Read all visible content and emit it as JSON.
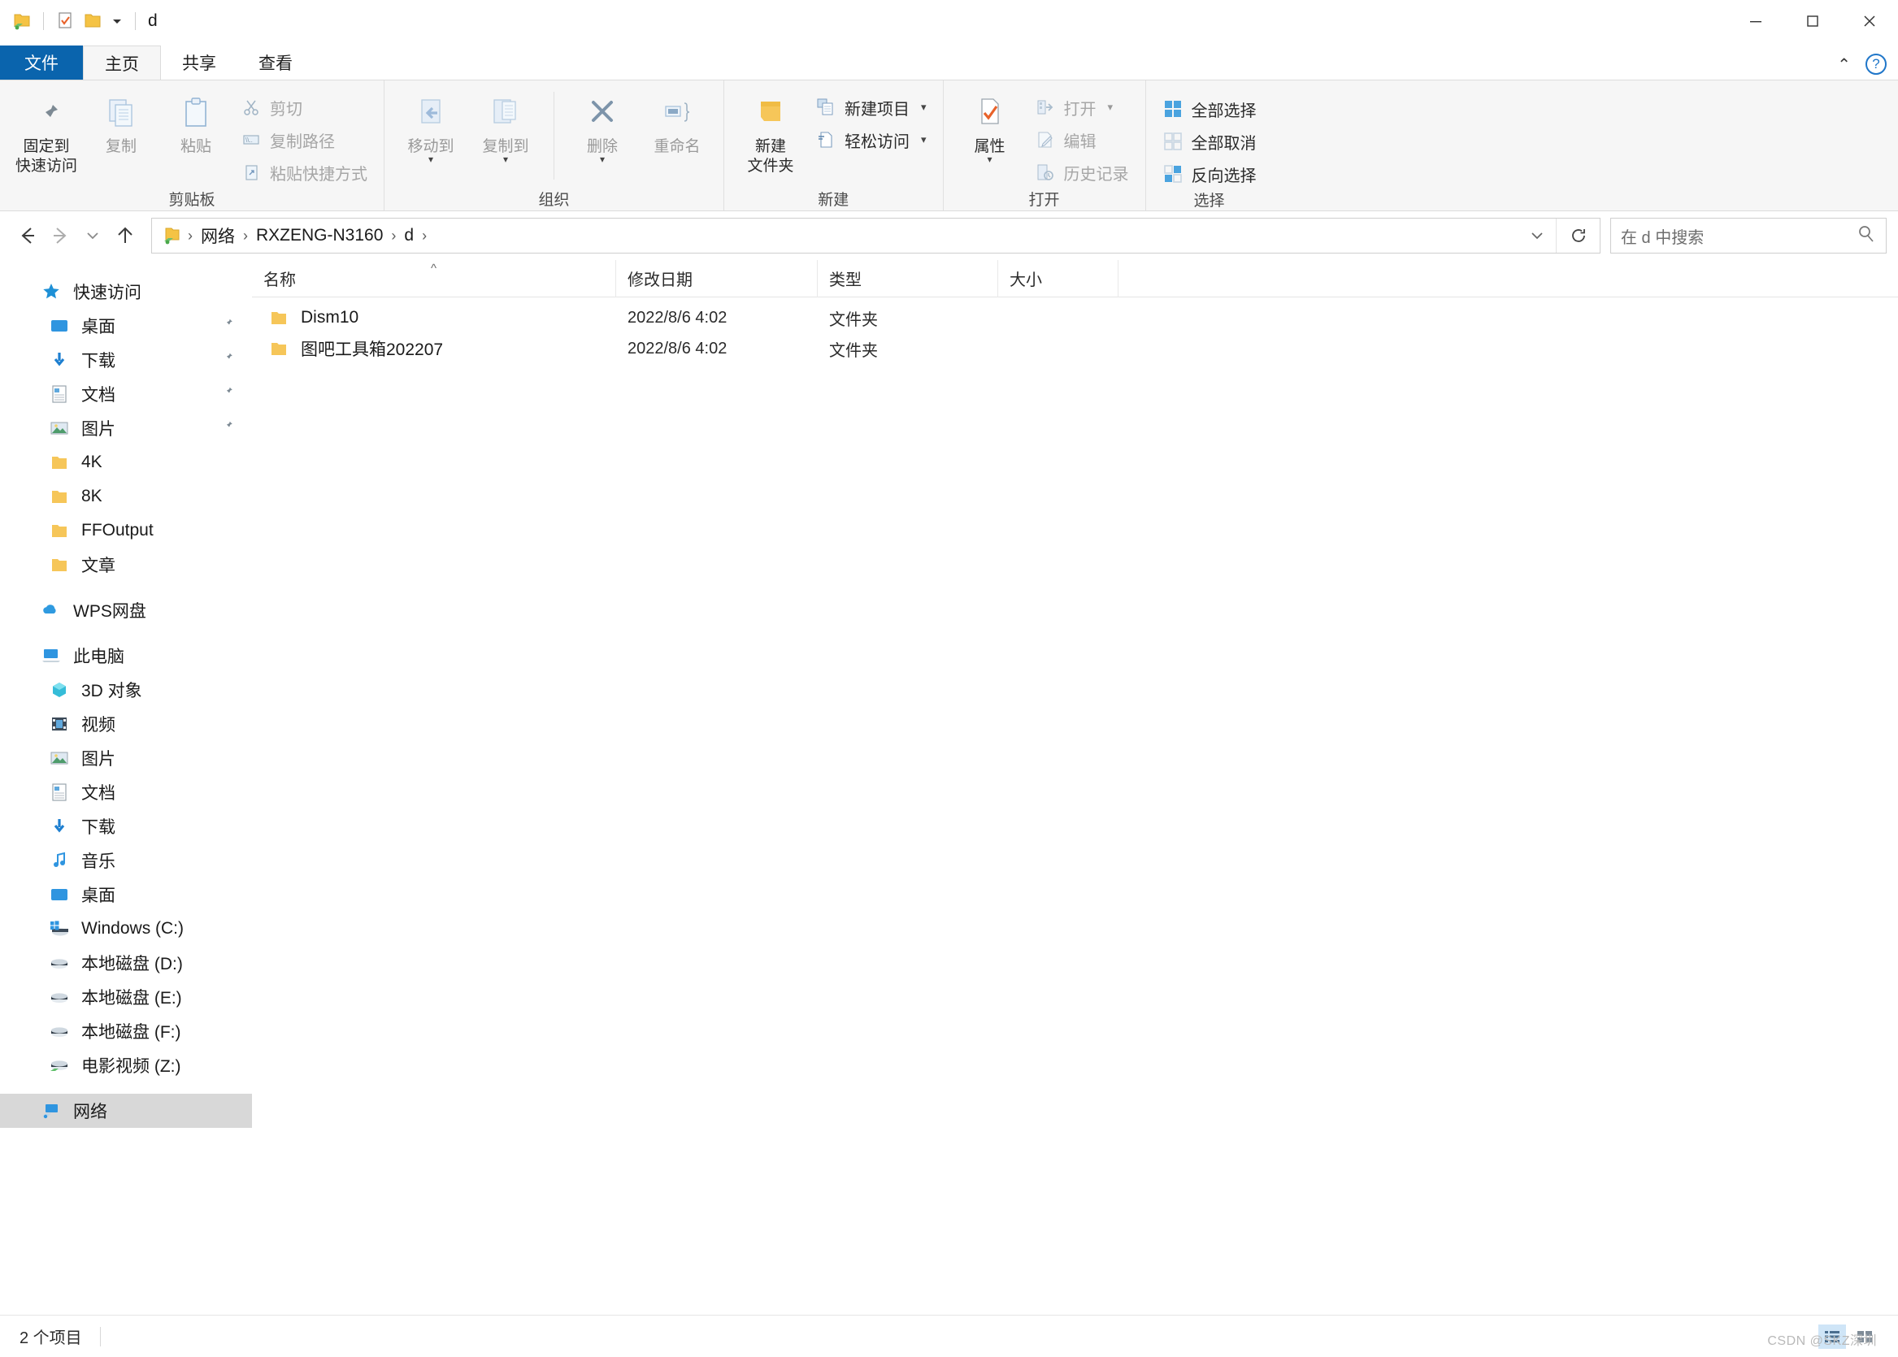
{
  "window": {
    "title": "d",
    "minimize_label": "最小化",
    "maximize_label": "最大化",
    "close_label": "关闭"
  },
  "quick_access_toolbar": {
    "items": [
      {
        "name": "network-folder-icon",
        "label": "网络文件夹"
      },
      {
        "name": "properties-icon",
        "label": "属性"
      },
      {
        "name": "new-folder-icon",
        "label": "新建文件夹"
      },
      {
        "name": "customize-caret",
        "label": "自定义快速访问工具栏"
      }
    ]
  },
  "tabs": [
    {
      "id": "file",
      "label": "文件"
    },
    {
      "id": "home",
      "label": "主页"
    },
    {
      "id": "share",
      "label": "共享"
    },
    {
      "id": "view",
      "label": "查看"
    }
  ],
  "ribbon": {
    "groups": [
      {
        "id": "clipboard",
        "label": "剪贴板",
        "big_buttons": [
          {
            "id": "pin-to-quick-access",
            "label": "固定到\n快速访问",
            "icon": "pin-icon",
            "dim": false
          },
          {
            "id": "copy",
            "label": "复制",
            "icon": "copy-icon",
            "dim": true
          },
          {
            "id": "paste",
            "label": "粘贴",
            "icon": "paste-icon",
            "dim": true
          }
        ],
        "small_buttons": [
          {
            "id": "cut",
            "label": "剪切",
            "icon": "scissors-icon",
            "dim": true
          },
          {
            "id": "copy-path",
            "label": "复制路径",
            "icon": "copy-path-icon",
            "dim": true
          },
          {
            "id": "paste-shortcut",
            "label": "粘贴快捷方式",
            "icon": "paste-shortcut-icon",
            "dim": true
          }
        ]
      },
      {
        "id": "organize",
        "label": "组织",
        "big_buttons": [
          {
            "id": "move-to",
            "label": "移动到",
            "icon": "move-to-icon",
            "dim": true,
            "caret": true
          },
          {
            "id": "copy-to",
            "label": "复制到",
            "icon": "copy-to-icon",
            "dim": true,
            "caret": true
          },
          {
            "id": "delete",
            "label": "删除",
            "icon": "delete-x-icon",
            "dim": true,
            "caret": true
          },
          {
            "id": "rename",
            "label": "重命名",
            "icon": "rename-icon",
            "dim": true,
            "caret": false
          }
        ]
      },
      {
        "id": "new",
        "label": "新建",
        "big_buttons": [
          {
            "id": "new-folder",
            "label": "新建\n文件夹",
            "icon": "new-folder-yellow-icon",
            "dim": false
          }
        ],
        "small_buttons": [
          {
            "id": "new-item",
            "label": "新建项目",
            "icon": "new-item-icon",
            "dim": false,
            "caret": true
          },
          {
            "id": "easy-access",
            "label": "轻松访问",
            "icon": "easy-access-icon",
            "dim": false,
            "caret": true
          }
        ]
      },
      {
        "id": "open",
        "label": "打开",
        "big_buttons": [
          {
            "id": "properties",
            "label": "属性",
            "icon": "properties-check-icon",
            "dim": false,
            "caret": true
          }
        ],
        "small_buttons": [
          {
            "id": "open",
            "label": "打开",
            "icon": "open-icon",
            "dim": true,
            "caret": true
          },
          {
            "id": "edit",
            "label": "编辑",
            "icon": "edit-icon",
            "dim": true
          },
          {
            "id": "history",
            "label": "历史记录",
            "icon": "history-icon",
            "dim": true
          }
        ]
      },
      {
        "id": "select",
        "label": "选择",
        "small_buttons": [
          {
            "id": "select-all",
            "label": "全部选择",
            "icon": "select-all-icon",
            "dim": false
          },
          {
            "id": "select-none",
            "label": "全部取消",
            "icon": "select-none-icon",
            "dim": false
          },
          {
            "id": "invert-selection",
            "label": "反向选择",
            "icon": "invert-selection-icon",
            "dim": false
          }
        ]
      }
    ]
  },
  "address_bar": {
    "back_label": "后退",
    "forward_label": "前进",
    "recent_label": "最近浏览的位置",
    "up_label": "上移到",
    "breadcrumb_icon": "network-folder-icon",
    "crumbs": [
      "网络",
      "RXZENG-N3160",
      "d"
    ],
    "dropdown_label": "历史记录",
    "refresh_label": "刷新",
    "search_placeholder": "在 d 中搜索",
    "search_icon": "search-icon"
  },
  "sidebar": {
    "sections": [
      {
        "id": "quick-access",
        "root": {
          "label": "快速访问",
          "icon": "star-icon"
        },
        "items": [
          {
            "label": "桌面",
            "icon": "desktop-icon",
            "pinned": true
          },
          {
            "label": "下载",
            "icon": "downloads-icon",
            "pinned": true
          },
          {
            "label": "文档",
            "icon": "documents-icon",
            "pinned": true
          },
          {
            "label": "图片",
            "icon": "pictures-icon",
            "pinned": true
          },
          {
            "label": "4K",
            "icon": "folder-icon",
            "pinned": false
          },
          {
            "label": "8K",
            "icon": "folder-icon",
            "pinned": false
          },
          {
            "label": "FFOutput",
            "icon": "folder-icon",
            "pinned": false
          },
          {
            "label": "文章",
            "icon": "folder-icon",
            "pinned": false
          }
        ]
      },
      {
        "id": "wps-cloud",
        "root": {
          "label": "WPS网盘",
          "icon": "cloud-icon"
        },
        "items": []
      },
      {
        "id": "this-pc",
        "root": {
          "label": "此电脑",
          "icon": "this-pc-icon"
        },
        "items": [
          {
            "label": "3D 对象",
            "icon": "3d-objects-icon",
            "pinned": false
          },
          {
            "label": "视频",
            "icon": "videos-icon",
            "pinned": false
          },
          {
            "label": "图片",
            "icon": "pictures-icon",
            "pinned": false
          },
          {
            "label": "文档",
            "icon": "documents-icon",
            "pinned": false
          },
          {
            "label": "下载",
            "icon": "downloads-icon",
            "pinned": false
          },
          {
            "label": "音乐",
            "icon": "music-icon",
            "pinned": false
          },
          {
            "label": "桌面",
            "icon": "desktop-icon",
            "pinned": false
          },
          {
            "label": "Windows (C:)",
            "icon": "windows-drive-icon",
            "pinned": false
          },
          {
            "label": "本地磁盘 (D:)",
            "icon": "drive-icon",
            "pinned": false
          },
          {
            "label": "本地磁盘 (E:)",
            "icon": "drive-icon",
            "pinned": false
          },
          {
            "label": "本地磁盘 (F:)",
            "icon": "drive-icon",
            "pinned": false
          },
          {
            "label": "电影视频 (Z:)",
            "icon": "network-drive-icon",
            "pinned": false
          }
        ]
      },
      {
        "id": "network",
        "root": {
          "label": "网络",
          "icon": "network-icon",
          "selected": true
        },
        "items": []
      }
    ]
  },
  "file_list": {
    "columns": [
      {
        "id": "name",
        "label": "名称",
        "sorted": true,
        "sort_mark": "^"
      },
      {
        "id": "date",
        "label": "修改日期",
        "sorted": false
      },
      {
        "id": "type",
        "label": "类型",
        "sorted": false
      },
      {
        "id": "size",
        "label": "大小",
        "sorted": false
      }
    ],
    "rows": [
      {
        "name": "Dism10",
        "date": "2022/8/6 4:02",
        "type": "文件夹",
        "size": "",
        "icon": "folder-icon"
      },
      {
        "name": "图吧工具箱202207",
        "date": "2022/8/6 4:02",
        "type": "文件夹",
        "size": "",
        "icon": "folder-icon"
      }
    ]
  },
  "status_bar": {
    "item_count": "2 个项目",
    "view_details_label": "详细信息",
    "view_large_label": "大图标"
  },
  "watermark": "CSDN @SKZ深圳",
  "colors": {
    "accent": "#0a64ad",
    "selection": "#cce1f5",
    "folder_yellow": "#f6c659",
    "ribbon_bg": "#f6f6f6",
    "border": "#dcdcdc"
  }
}
